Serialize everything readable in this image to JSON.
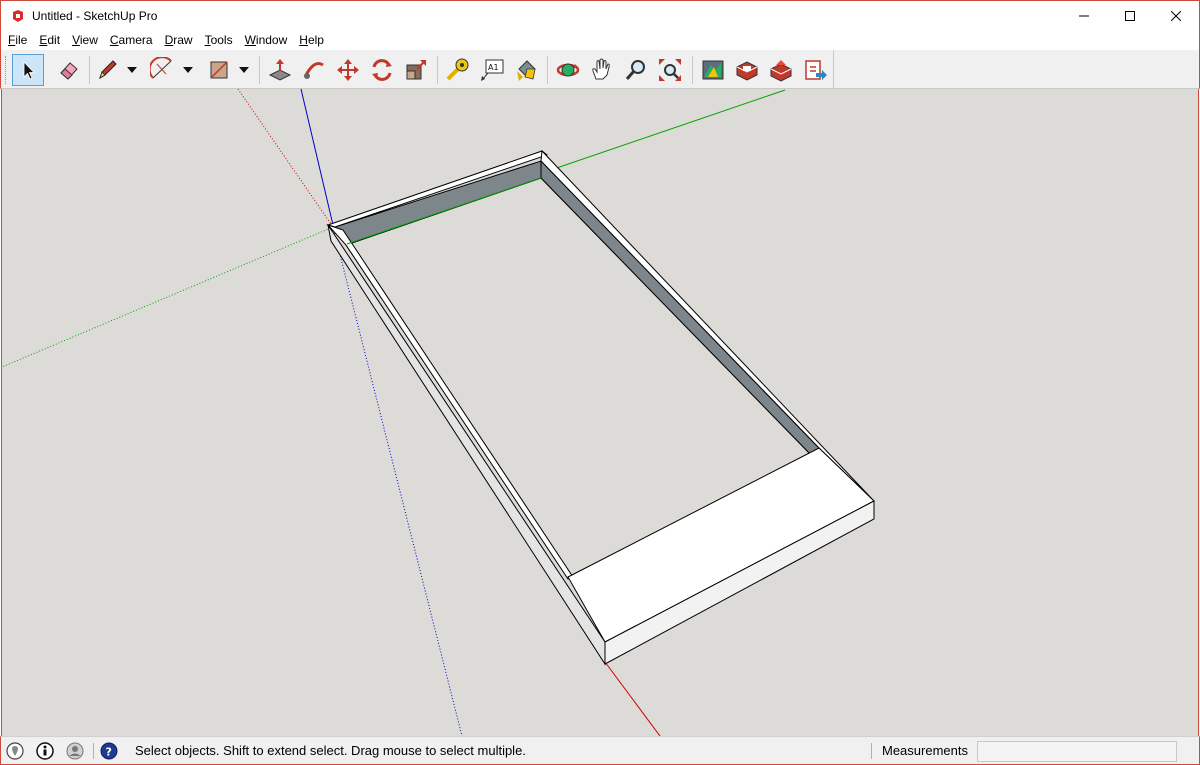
{
  "window": {
    "title": "Untitled - SketchUp Pro",
    "minimize_glyph": "—",
    "maximize_glyph": "☐",
    "close_glyph": "✕"
  },
  "menu": [
    {
      "label": "File",
      "underline": "F"
    },
    {
      "label": "Edit",
      "underline": "E"
    },
    {
      "label": "View",
      "underline": "V"
    },
    {
      "label": "Camera",
      "underline": "C"
    },
    {
      "label": "Draw",
      "underline": "D"
    },
    {
      "label": "Tools",
      "underline": "T"
    },
    {
      "label": "Window",
      "underline": "W"
    },
    {
      "label": "Help",
      "underline": "H"
    }
  ],
  "toolbar": {
    "tools": [
      {
        "name": "select-tool",
        "icon": "select-arrow-icon",
        "active": true
      },
      {
        "name": "eraser-tool",
        "icon": "eraser-icon"
      },
      {
        "name": "line-tool",
        "icon": "pencil-icon",
        "dropdown": true
      },
      {
        "name": "arc-tool",
        "icon": "arc-icon",
        "dropdown": true
      },
      {
        "name": "shape-tool",
        "icon": "rectangle-icon",
        "dropdown": true
      },
      {
        "name": "push-pull-tool",
        "icon": "push-pull-icon"
      },
      {
        "name": "follow-me-tool",
        "icon": "follow-me-icon"
      },
      {
        "name": "move-tool",
        "icon": "move-icon"
      },
      {
        "name": "rotate-tool",
        "icon": "rotate-icon"
      },
      {
        "name": "scale-tool",
        "icon": "scale-icon"
      },
      {
        "name": "tape-measure-tool",
        "icon": "tape-measure-icon"
      },
      {
        "name": "text-tool",
        "icon": "text-icon",
        "label": "A1"
      },
      {
        "name": "paint-bucket-tool",
        "icon": "paint-bucket-icon"
      },
      {
        "name": "orbit-tool",
        "icon": "orbit-icon"
      },
      {
        "name": "pan-tool",
        "icon": "hand-icon"
      },
      {
        "name": "zoom-tool",
        "icon": "magnifier-icon"
      },
      {
        "name": "zoom-extents-tool",
        "icon": "zoom-extents-icon"
      },
      {
        "name": "warehouse-tool",
        "icon": "warehouse-icon"
      },
      {
        "name": "extension-warehouse-tool",
        "icon": "extension-icon"
      },
      {
        "name": "share-model-tool",
        "icon": "share-icon"
      },
      {
        "name": "layout-send-tool",
        "icon": "send-to-layout-icon"
      }
    ]
  },
  "colors": {
    "viewport_bg": "#dcdbd7",
    "window_border": "#d04a3a",
    "axis_red": "#cc0000",
    "axis_green": "#00a000",
    "axis_blue": "#0000cc",
    "face_top": "#ffffff",
    "face_side": "#e6e6e6",
    "face_inner": "#7d868b"
  },
  "statusbar": {
    "icons": [
      "geo-location-icon",
      "credits-icon",
      "user-icon",
      "help-icon"
    ],
    "message": "Select objects. Shift to extend select. Drag mouse to select multiple.",
    "measurements_label": "Measurements",
    "measurements_value": ""
  }
}
